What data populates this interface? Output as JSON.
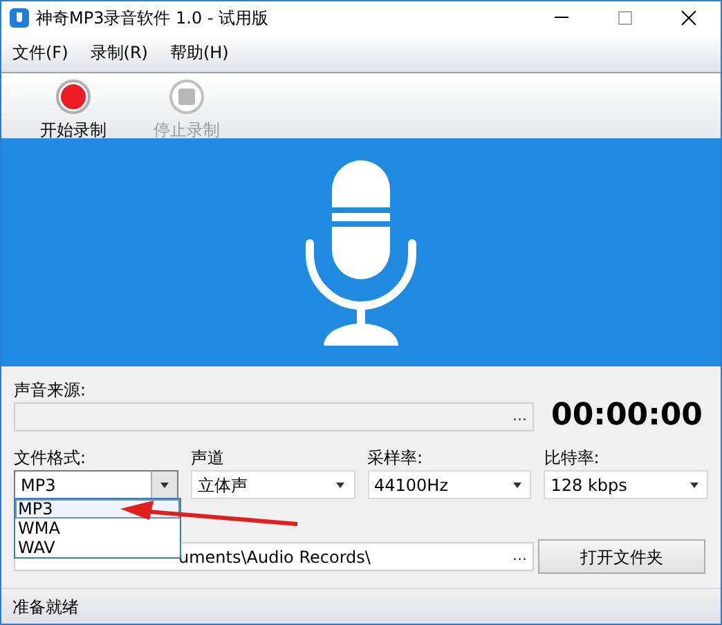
{
  "window": {
    "title": "神奇MP3录音软件 1.0 - 试用版"
  },
  "menu": [
    {
      "label": "文件(F)"
    },
    {
      "label": "录制(R)"
    },
    {
      "label": "帮助(H)"
    }
  ],
  "toolbar": [
    {
      "label": "开始录制",
      "kind": "record",
      "disabled": false
    },
    {
      "label": "停止录制",
      "kind": "stop",
      "disabled": true
    }
  ],
  "source": {
    "label": "声音来源:",
    "browse": "..."
  },
  "timer": "00:00:00",
  "settings": [
    {
      "label": "文件格式:",
      "value": "MP3",
      "expanded": true,
      "options": [
        {
          "label": "MP3",
          "selected": true
        },
        {
          "label": "WMA",
          "selected": false
        },
        {
          "label": "WAV",
          "selected": false
        }
      ]
    },
    {
      "label": "声道",
      "value": "立体声",
      "expanded": false
    },
    {
      "label": "采样率:",
      "value": "44100Hz",
      "expanded": false
    },
    {
      "label": "比特率:",
      "value": "128 kbps",
      "expanded": false
    }
  ],
  "output": {
    "path": "uments\\Audio Records\\",
    "browse": "...",
    "button": "打开文件夹"
  },
  "status_bar": "准备就绪"
}
